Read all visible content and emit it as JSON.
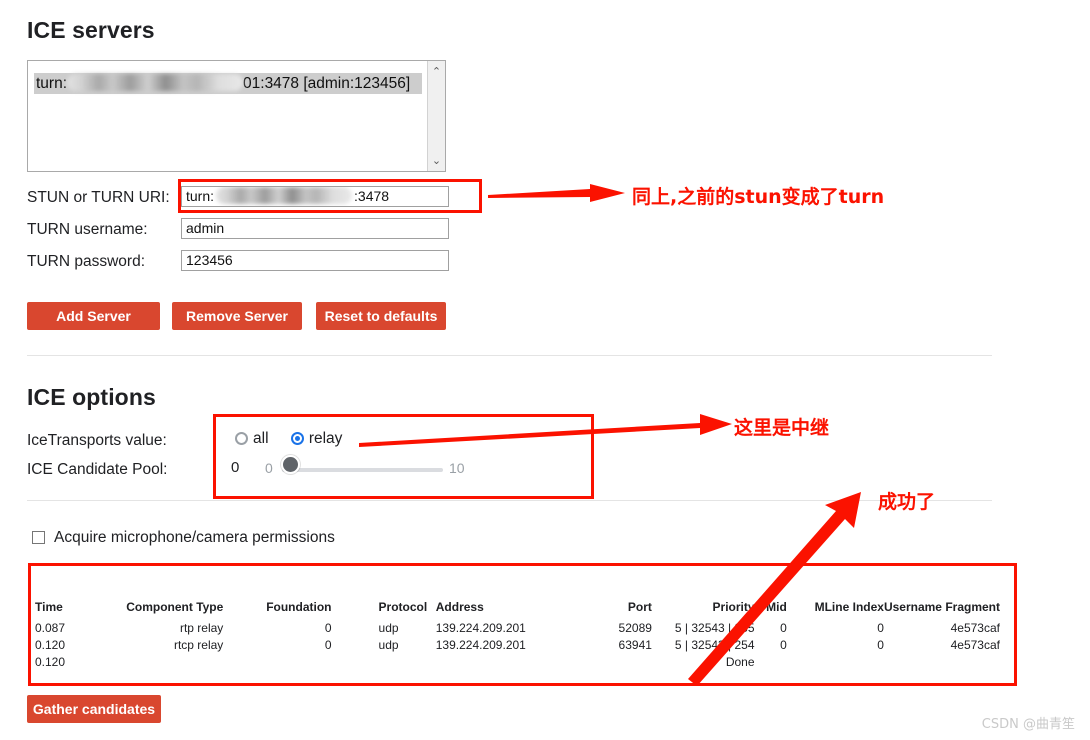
{
  "sections": {
    "ice_servers_title": "ICE servers",
    "ice_options_title": "ICE options"
  },
  "server_list": {
    "selected_item_prefix": "turn:",
    "selected_item_suffix": "01:3478 [admin:123456]",
    "scroll_up_icon": "⌃",
    "scroll_down_icon": "⌄"
  },
  "form": {
    "uri_label": "STUN or TURN URI:",
    "uri_value_prefix": "turn:",
    "uri_value_suffix": ":3478",
    "username_label": "TURN username:",
    "username_value": "admin",
    "password_label": "TURN password:",
    "password_value": "123456"
  },
  "buttons": {
    "add_server": "Add Server",
    "remove_server": "Remove Server",
    "reset_to_defaults": "Reset to defaults",
    "gather_candidates": "Gather candidates"
  },
  "ice_options": {
    "icetransports_label": "IceTransports value:",
    "radio_all": "all",
    "radio_relay": "relay",
    "selected_transport": "relay",
    "pool_label": "ICE Candidate Pool:",
    "pool_value": "0",
    "pool_min": "0",
    "pool_max": "10"
  },
  "permissions": {
    "label": "Acquire microphone/camera permissions",
    "checked": false
  },
  "candidates": {
    "headers": [
      "Time",
      "Component Type",
      "Foundation",
      "Protocol",
      "Address",
      "Port",
      "Priority",
      "Mid",
      "MLine Index",
      "Username Fragment"
    ],
    "rows": [
      {
        "time": "0.087",
        "component_type": "rtp relay",
        "foundation": "0",
        "protocol": "udp",
        "address": "139.224.209.201",
        "port": "52089",
        "priority": "5 | 32543 | 255",
        "mid": "0",
        "mline_index": "0",
        "username_fragment": "4e573caf"
      },
      {
        "time": "0.120",
        "component_type": "rtcp relay",
        "foundation": "0",
        "protocol": "udp",
        "address": "139.224.209.201",
        "port": "63941",
        "priority": "5 | 32543 | 254",
        "mid": "0",
        "mline_index": "0",
        "username_fragment": "4e573caf"
      },
      {
        "time": "0.120",
        "component_type": "",
        "foundation": "",
        "protocol": "",
        "address": "",
        "port": "",
        "priority": "Done",
        "mid": "",
        "mline_index": "",
        "username_fragment": ""
      }
    ]
  },
  "annotations": {
    "note_uri": "同上,之前的stun变成了turn",
    "note_relay": "这里是中继",
    "note_success": "成功了",
    "color": "#fb1200"
  },
  "watermark": "CSDN @曲青笙",
  "theme": {
    "button_red": "#d9472f",
    "radio_blue": "#1a73e8",
    "annotation_red": "#fb1200"
  }
}
